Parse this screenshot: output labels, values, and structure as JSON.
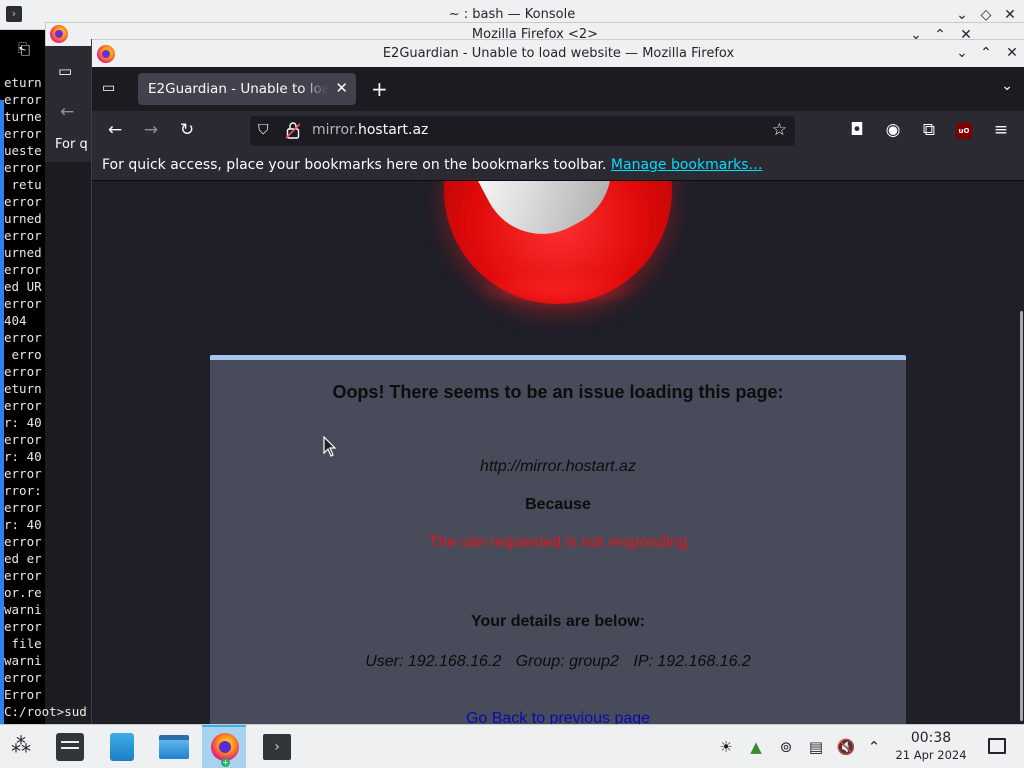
{
  "konsole": {
    "title": "~ : bash — Konsole",
    "lines": [
      "eturn",
      "error",
      "turne",
      "error",
      "ueste",
      "error",
      " retu",
      "error",
      "urned",
      "error",
      "urned",
      "error",
      "ed UR",
      "error",
      "404",
      "error",
      " erro",
      "error",
      "eturn",
      "error",
      "r: 40",
      "error",
      "r: 40",
      "error",
      "rror:",
      "error",
      "r: 40",
      "error",
      "ed er",
      "error",
      "or.re",
      "warni",
      "error",
      " file",
      "warni",
      "error",
      "Error"
    ],
    "prompt": "C:/root>sud"
  },
  "firefox_back_window": {
    "title": "Mozilla Firefox <2>",
    "bookmarks_text": "For q"
  },
  "firefox": {
    "window_title": "E2Guardian - Unable to load website — Mozilla Firefox",
    "tab_title": "E2Guardian - Unable to load website",
    "url_prefix": "mirror.",
    "url_domain": "hostart.az",
    "bookmarks_message": "For quick access, place your bookmarks here on the bookmarks toolbar.",
    "bookmarks_link": "Manage bookmarks…"
  },
  "page": {
    "heading": "Oops! There seems to be an issue loading this page:",
    "url": "http://mirror.hostart.az",
    "because": "Because",
    "reason": "The site requested is not responding",
    "details_heading": "Your details are below:",
    "user": "User: 192.168.16.2",
    "group": "Group: group2",
    "ip": "IP: 192.168.16.2",
    "back_link": "Go Back to previous page"
  },
  "taskbar": {
    "time": "00:38",
    "date": "21 Apr 2024"
  },
  "colors": {
    "accent": "#3daee9",
    "error_text": "#e3141a",
    "box_border": "#a6c6f0"
  }
}
